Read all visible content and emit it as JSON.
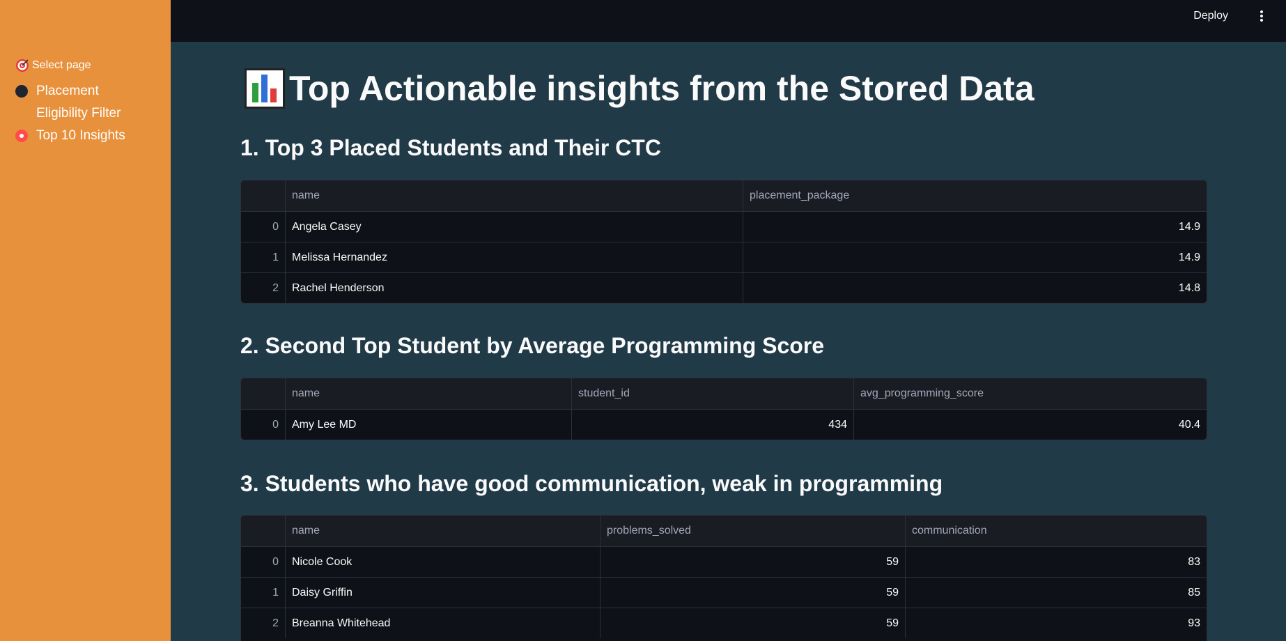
{
  "sidebar": {
    "label": "Select page",
    "options": [
      {
        "label": "Placement Eligibility Filter",
        "selected": false
      },
      {
        "label": "Top 10 Insights",
        "selected": true
      }
    ],
    "accent_color": "#e8913c"
  },
  "header": {
    "deploy_label": "Deploy",
    "menu_icon": "kebab-menu-icon"
  },
  "main": {
    "title": "Top Actionable insights from the Stored Data",
    "title_icon": "bar-chart-icon",
    "sections": [
      {
        "heading": "1. Top 3 Placed Students and Their CTC",
        "columns": [
          "name",
          "placement_package"
        ],
        "rows": [
          {
            "index": "0",
            "cells": [
              "Angela Casey",
              "14.9"
            ]
          },
          {
            "index": "1",
            "cells": [
              "Melissa Hernandez",
              "14.9"
            ]
          },
          {
            "index": "2",
            "cells": [
              "Rachel Henderson",
              "14.8"
            ]
          }
        ]
      },
      {
        "heading": "2. Second Top Student by Average Programming Score",
        "columns": [
          "name",
          "student_id",
          "avg_programming_score"
        ],
        "rows": [
          {
            "index": "0",
            "cells": [
              "Amy Lee MD",
              "434",
              "40.4"
            ]
          }
        ]
      },
      {
        "heading": "3. Students who have good communication, weak in programming",
        "columns": [
          "name",
          "problems_solved",
          "communication"
        ],
        "rows": [
          {
            "index": "0",
            "cells": [
              "Nicole Cook",
              "59",
              "83"
            ]
          },
          {
            "index": "1",
            "cells": [
              "Daisy Griffin",
              "59",
              "85"
            ]
          },
          {
            "index": "2",
            "cells": [
              "Breanna Whitehead",
              "59",
              "93"
            ]
          }
        ]
      }
    ]
  }
}
